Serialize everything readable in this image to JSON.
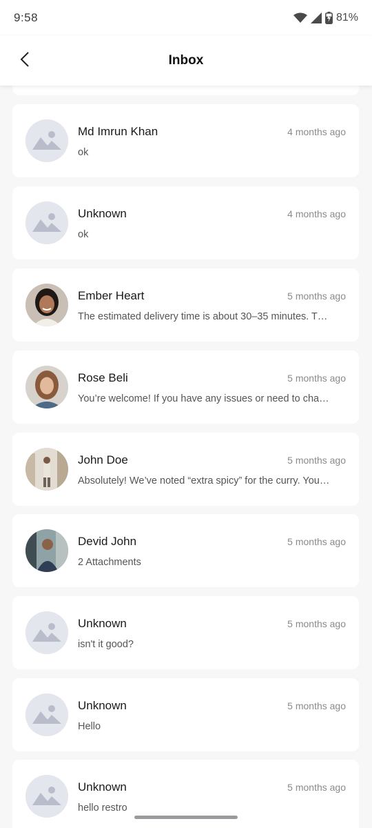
{
  "status_bar": {
    "time": "9:58",
    "battery": "81%",
    "icons": [
      "wifi-icon",
      "signal-icon",
      "battery-charging-icon"
    ]
  },
  "header": {
    "title": "Inbox",
    "back_icon": "chevron-left-icon"
  },
  "conversations": [
    {
      "name": "Md Imrun Khan",
      "time": "4 months ago",
      "preview": "ok",
      "avatar": "placeholder-image-icon"
    },
    {
      "name": "Unknown",
      "time": "4 months ago",
      "preview": "ok",
      "avatar": "placeholder-image-icon"
    },
    {
      "name": "Ember Heart",
      "time": "5 months ago",
      "preview": "The estimated delivery time is about 30–35 minutes. T…",
      "avatar": "photo"
    },
    {
      "name": "Rose Beli",
      "time": "5 months ago",
      "preview": "You’re welcome! If you have any issues or need to cha…",
      "avatar": "photo"
    },
    {
      "name": "John Doe",
      "time": "5 months ago",
      "preview": "Absolutely! We’ve noted “extra spicy” for the curry. You…",
      "avatar": "photo"
    },
    {
      "name": "Devid John",
      "time": "5 months ago",
      "preview": "2 Attachments",
      "avatar": "photo"
    },
    {
      "name": "Unknown",
      "time": "5 months ago",
      "preview": "isn't it good?",
      "avatar": "placeholder-image-icon"
    },
    {
      "name": "Unknown",
      "time": "5 months ago",
      "preview": "Hello",
      "avatar": "placeholder-image-icon"
    },
    {
      "name": "Unknown",
      "time": "5 months ago",
      "preview": "hello restro",
      "avatar": "placeholder-image-icon"
    }
  ],
  "colors": {
    "background": "#f7f7f8",
    "card": "#ffffff",
    "placeholder_avatar": "#e4e6ee",
    "secondary_text": "#8a8a8e"
  }
}
